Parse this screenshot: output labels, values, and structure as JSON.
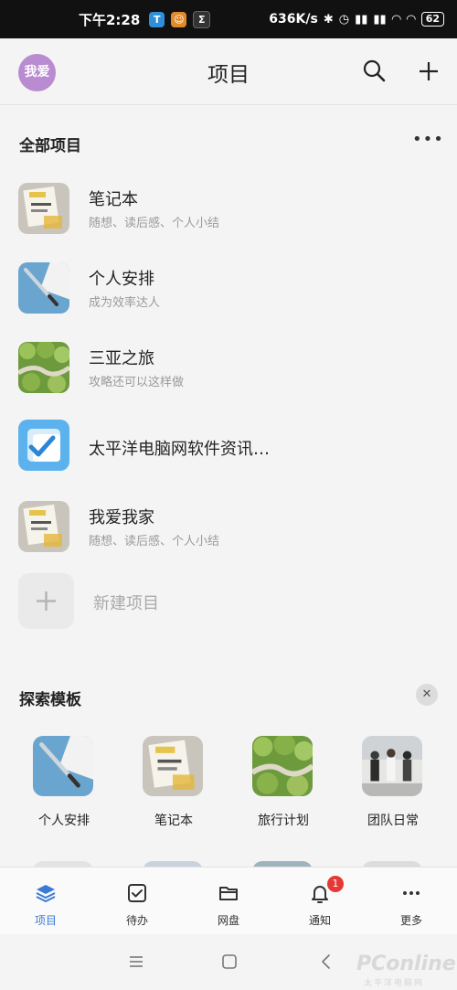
{
  "status_bar": {
    "time": "下午2:28",
    "net_speed": "636K/s",
    "battery": "62"
  },
  "header": {
    "avatar_text": "我爱",
    "title": "项目"
  },
  "projects_section": {
    "title": "全部项目",
    "items": [
      {
        "name": "笔记本",
        "desc": "随想、读后感、个人小结",
        "thumb": "notes"
      },
      {
        "name": "个人安排",
        "desc": "成为效率达人",
        "thumb": "pen"
      },
      {
        "name": "三亚之旅",
        "desc": "攻略还可以这样做",
        "thumb": "forest"
      },
      {
        "name": "太平洋电脑网软件资讯…",
        "desc": "",
        "thumb": "checkbox"
      },
      {
        "name": "我爱我家",
        "desc": "随想、读后感、个人小结",
        "thumb": "notes"
      }
    ],
    "new_label": "新建项目"
  },
  "templates_section": {
    "title": "探索模板",
    "items": [
      {
        "label": "个人安排",
        "thumb": "pen"
      },
      {
        "label": "笔记本",
        "thumb": "notes"
      },
      {
        "label": "旅行计划",
        "thumb": "forest"
      },
      {
        "label": "团队日常",
        "thumb": "team"
      }
    ]
  },
  "tab_bar": {
    "tabs": [
      {
        "label": "项目",
        "icon": "layers-icon",
        "active": true
      },
      {
        "label": "待办",
        "icon": "checkbox-icon"
      },
      {
        "label": "网盘",
        "icon": "folder-icon"
      },
      {
        "label": "通知",
        "icon": "bell-icon",
        "badge": "1"
      },
      {
        "label": "更多",
        "icon": "more-icon"
      }
    ]
  },
  "watermark": {
    "text": "PConline",
    "sub": "太平洋电脑网"
  },
  "colors": {
    "accent": "#3a7bd5",
    "avatar": "#b98bd0",
    "badge": "#e53935"
  }
}
